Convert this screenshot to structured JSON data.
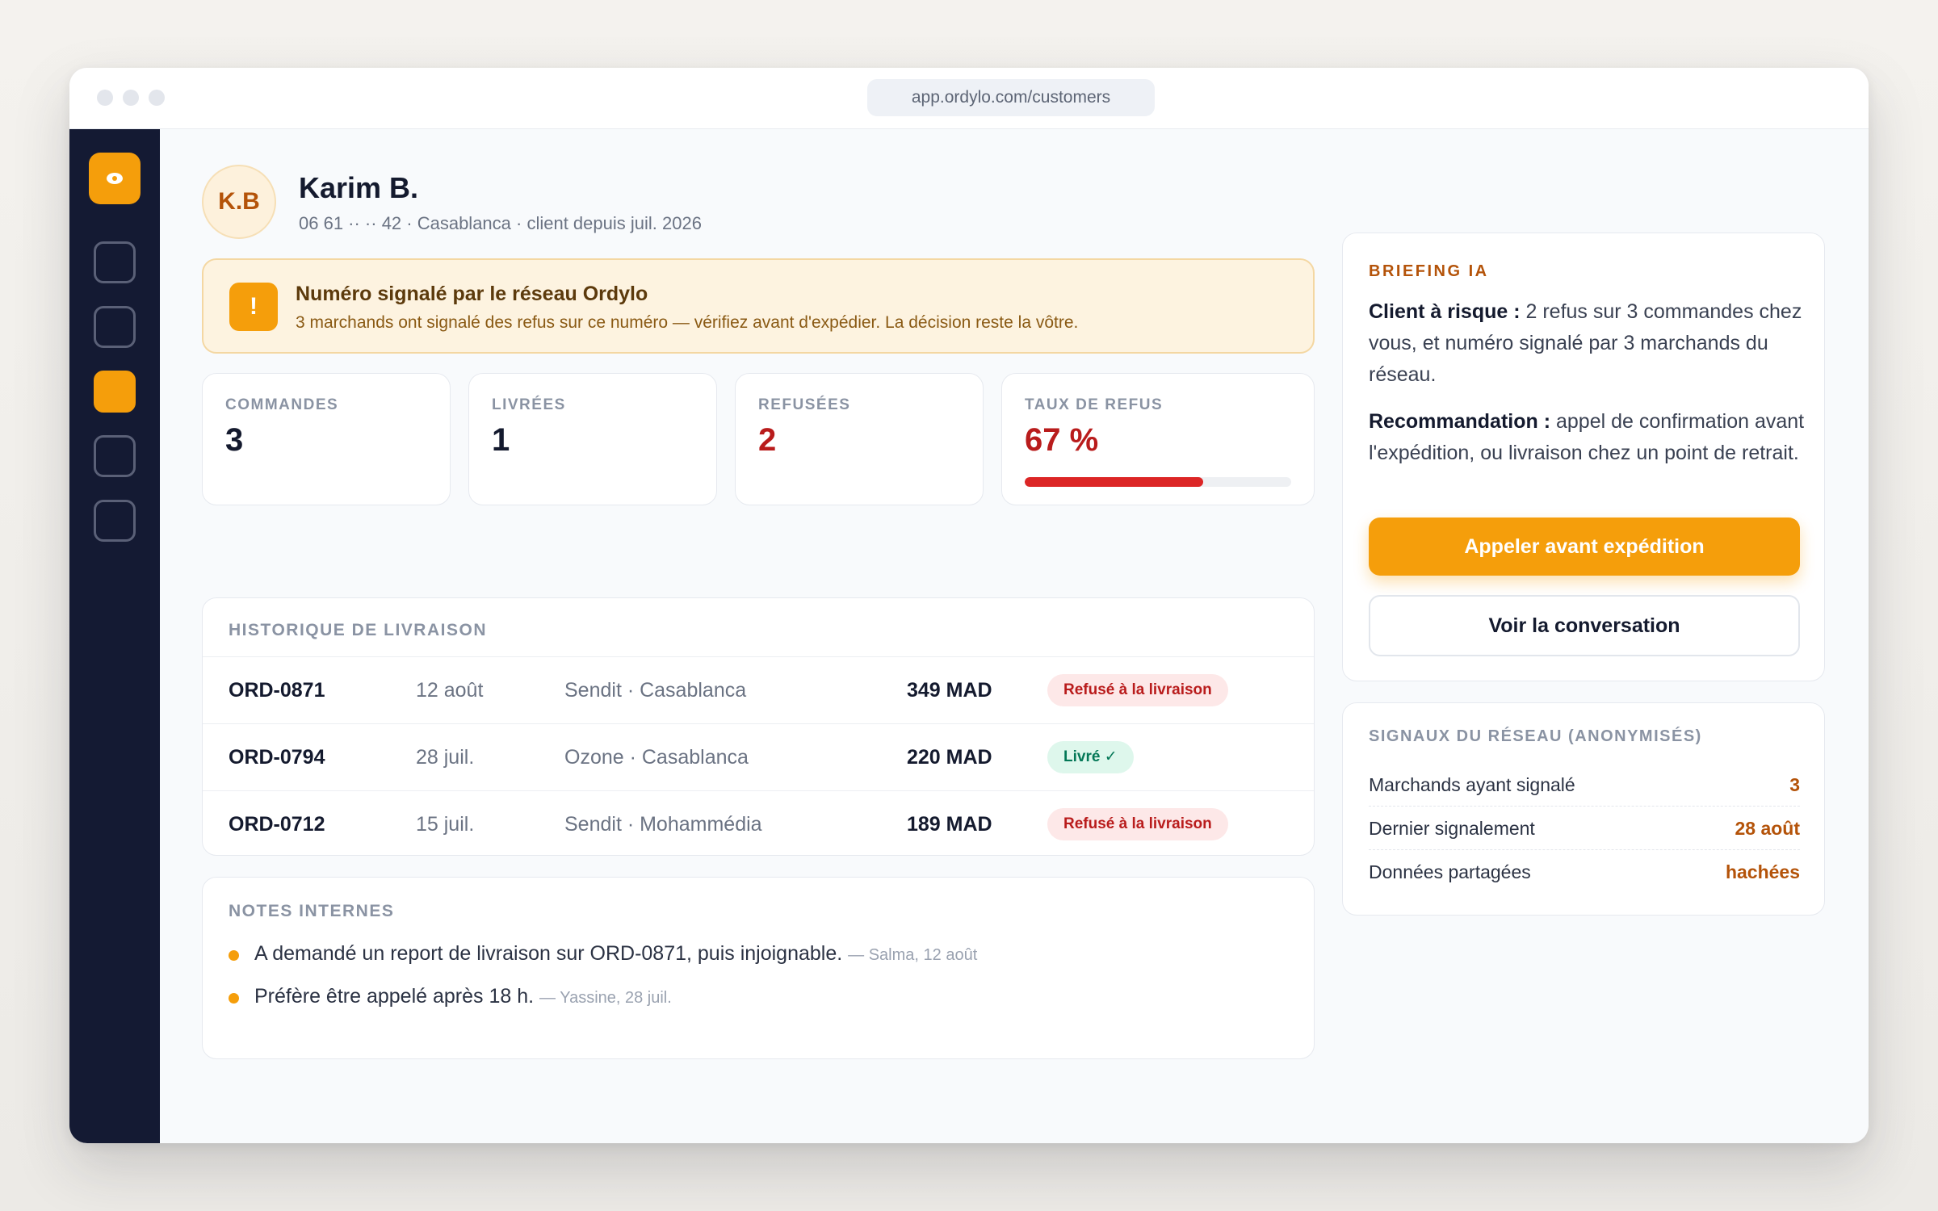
{
  "browser": {
    "url": "app.ordylo.com/customers"
  },
  "customer": {
    "initials": "K.B",
    "name": "Karim B.",
    "subtitle": "06 61 ·· ·· 42 · Casablanca · client depuis juil. 2026"
  },
  "alert": {
    "icon": "!",
    "title": "Numéro signalé par le réseau Ordylo",
    "text": "3 marchands ont signalé des refus sur ce numéro — vérifiez avant d'expédier. La décision reste la vôtre."
  },
  "stats": {
    "orders": {
      "label": "COMMANDES",
      "value": "3"
    },
    "delivered": {
      "label": "LIVRÉES",
      "value": "1"
    },
    "refused": {
      "label": "REFUSÉES",
      "value": "2"
    },
    "refusal_rate": {
      "label": "TAUX DE REFUS",
      "value": "67 %",
      "fraction": 0.67
    }
  },
  "history": {
    "title": "HISTORIQUE DE LIVRAISON",
    "rows": [
      {
        "id": "ORD-0871",
        "date": "12 août",
        "carrier": "Sendit · Casablanca",
        "amount": "349 MAD",
        "status": "Refusé à la livraison"
      },
      {
        "id": "ORD-0794",
        "date": "28 juil.",
        "carrier": "Ozone · Casablanca",
        "amount": "220 MAD",
        "status": "Livré ✓"
      },
      {
        "id": "ORD-0712",
        "date": "15 juil.",
        "carrier": "Sendit · Mohammédia",
        "amount": "189 MAD",
        "status": "Refusé à la livraison"
      }
    ]
  },
  "notes": {
    "title": "NOTES INTERNES",
    "items": [
      {
        "text": "A demandé un report de livraison sur ORD-0871, puis injoignable.",
        "meta": "— Salma, 12 août"
      },
      {
        "text": "Préfère être appelé après 18 h.",
        "meta": "— Yassine, 28 juil."
      }
    ]
  },
  "briefing": {
    "title": "BRIEFING IA",
    "risk_label": "Client à risque :",
    "risk_text": "2 refus sur 3 commandes chez vous, et numéro signalé par 3 marchands du réseau.",
    "reco_label": "Recommandation :",
    "reco_text": "appel de confirmation avant l'expédition, ou livraison chez un point de retrait.",
    "primary_button": "Appeler avant expédition",
    "secondary_button": "Voir la conversation"
  },
  "signals": {
    "title": "SIGNAUX DU RÉSEAU (ANONYMISÉS)",
    "rows": [
      {
        "label": "Marchands ayant signalé",
        "value": "3"
      },
      {
        "label": "Dernier signalement",
        "value": "28 août"
      },
      {
        "label": "Données partagées",
        "value": "hachées"
      }
    ]
  },
  "colors": {
    "accent": "#f59e0b",
    "sidebar": "#141a33",
    "danger": "#dc2626",
    "success": "#047857"
  },
  "icons": [
    "logo-eye-icon",
    "warning-icon",
    "nav-icon",
    "bullet-icon"
  ]
}
